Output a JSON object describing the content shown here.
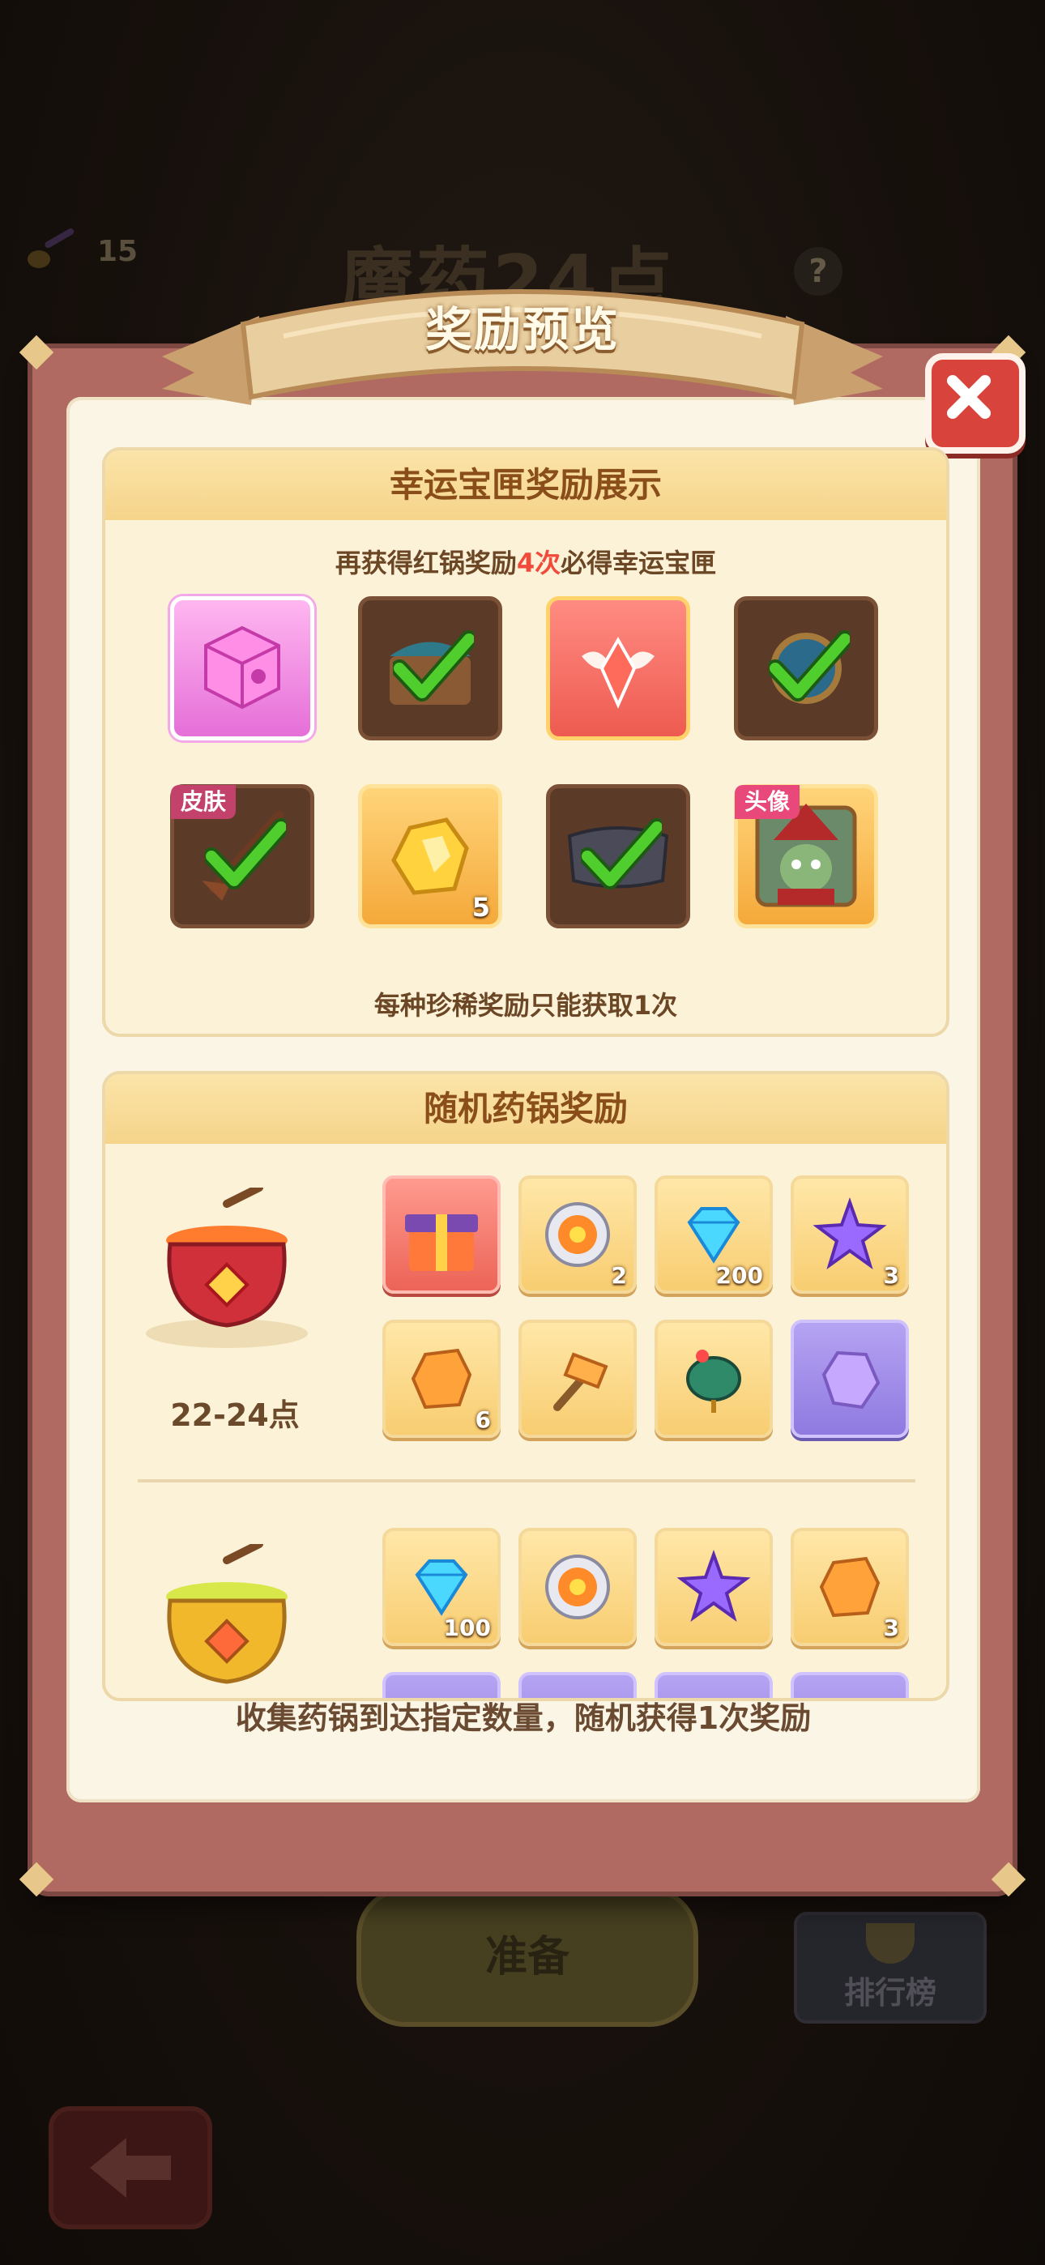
{
  "background": {
    "counter_value": "15",
    "title": "魔药24点",
    "help_label": "?",
    "ready_button": "准备",
    "rank_button": "排行榜"
  },
  "modal": {
    "title": "奖励预览",
    "close_label": "close",
    "lucky": {
      "header": "幸运宝匣奖励展示",
      "subtitle_prefix": "再获得红锅奖励",
      "subtitle_highlight": "4次",
      "subtitle_suffix": "必得幸运宝匣",
      "items": [
        {
          "icon": "pink-cube-icon",
          "style": "pink",
          "owned": false
        },
        {
          "icon": "treasure-chest-icon",
          "style": "owned",
          "owned": true
        },
        {
          "icon": "winged-crystal-icon",
          "style": "red",
          "owned": false
        },
        {
          "icon": "globe-frame-icon",
          "style": "owned",
          "owned": true
        },
        {
          "icon": "broom-skin-icon",
          "style": "owned",
          "owned": true,
          "tag": "皮肤"
        },
        {
          "icon": "gold-ore-icon",
          "style": "gold",
          "owned": false,
          "count": "5"
        },
        {
          "icon": "name-plate-icon",
          "style": "owned",
          "owned": true
        },
        {
          "icon": "goblin-wizard-avatar-icon",
          "style": "gold",
          "owned": false,
          "tag": "头像"
        }
      ],
      "footer": "每种珍稀奖励只能获取1次"
    },
    "random": {
      "header": "随机药锅奖励",
      "tiers": [
        {
          "label": "22-24点",
          "cauldron": "red-cauldron-icon",
          "items": [
            {
              "icon": "gift-box-icon",
              "style": "red",
              "count": ""
            },
            {
              "icon": "target-coin-icon",
              "style": "gold",
              "count": "2"
            },
            {
              "icon": "diamond-icon",
              "style": "gold",
              "count": "200"
            },
            {
              "icon": "purple-star-icon",
              "style": "gold",
              "count": "3"
            },
            {
              "icon": "orange-ore-icon",
              "style": "gold",
              "count": "6"
            },
            {
              "icon": "hammer-icon",
              "style": "gold",
              "count": ""
            },
            {
              "icon": "spinning-top-icon",
              "style": "gold",
              "count": ""
            },
            {
              "icon": "purple-ore-icon",
              "style": "purple",
              "count": ""
            }
          ]
        },
        {
          "label": "",
          "cauldron": "gold-cauldron-icon",
          "items": [
            {
              "icon": "diamond-icon",
              "style": "gold",
              "count": "100"
            },
            {
              "icon": "target-coin-icon",
              "style": "gold",
              "count": ""
            },
            {
              "icon": "purple-star-icon",
              "style": "gold",
              "count": ""
            },
            {
              "icon": "orange-ore-icon",
              "style": "gold",
              "count": "3"
            }
          ]
        }
      ]
    },
    "footer_note": "收集药锅到达指定数量，随机获得1次奖励"
  }
}
